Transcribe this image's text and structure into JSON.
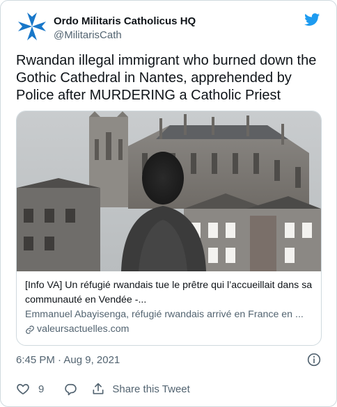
{
  "tweet": {
    "author": {
      "display_name": "Ordo Militaris Catholicus HQ",
      "handle": "@MilitarisCath",
      "avatar_icon": "maltese-cross-icon",
      "avatar_color": "#1877c9"
    },
    "platform_icon": "twitter-bird-icon",
    "accent_color": "#1d9bf0",
    "text": "Rwandan illegal immigrant who burned down the\nGothic Cathedral in Nantes, apprehended by\nPolice after MURDERING a Catholic Priest",
    "link_card": {
      "title": "[Info VA] Un réfugié rwandais tue le prêtre qui l’accueillait dans sa communauté en Vendée -...",
      "description": "Emmanuel Abayisenga, réfugié rwandais arrivé en France en ...",
      "domain": "valeursactuelles.com",
      "domain_icon": "link-icon",
      "image_description_icon": "cathedral-photo"
    },
    "timestamp": "6:45 PM · Aug 9, 2021",
    "info_icon": "info-icon",
    "actions": {
      "like_icon": "heart-icon",
      "like_count": "9",
      "reply_icon": "reply-icon",
      "share_icon": "share-icon",
      "share_label": "Share this Tweet"
    }
  }
}
